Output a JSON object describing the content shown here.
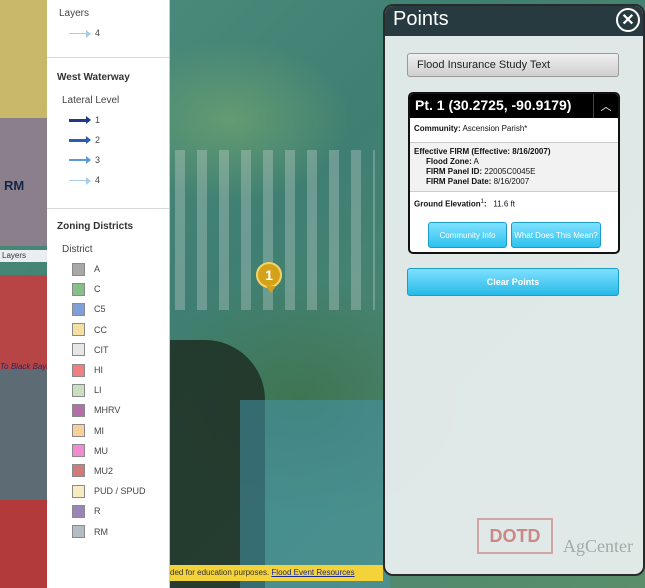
{
  "legend": {
    "layers_title": "Layers",
    "layers_item": "4",
    "west_waterway": {
      "heading": "West Waterway",
      "sub": "Lateral Level",
      "items": [
        {
          "label": "1",
          "color": "#1f3a80"
        },
        {
          "label": "2",
          "color": "#2a5cb0"
        },
        {
          "label": "3",
          "color": "#5b9ad8"
        },
        {
          "label": "4",
          "color": "#a9cbe8"
        }
      ]
    },
    "zoning": {
      "heading": "Zoning Districts",
      "sub": "District",
      "items": [
        {
          "label": "A",
          "color": "#a8a8a8"
        },
        {
          "label": "C",
          "color": "#86c086"
        },
        {
          "label": "C5",
          "color": "#7f9fd8"
        },
        {
          "label": "CC",
          "color": "#f6dfa0"
        },
        {
          "label": "CIT",
          "color": "#e6e6e6"
        },
        {
          "label": "HI",
          "color": "#f08080"
        },
        {
          "label": "LI",
          "color": "#c8dfc0"
        },
        {
          "label": "MHRV",
          "color": "#b46ea8"
        },
        {
          "label": "MI",
          "color": "#f6d29a"
        },
        {
          "label": "MU",
          "color": "#f08ccf"
        },
        {
          "label": "MU2",
          "color": "#d27a7a"
        },
        {
          "label": "PUD / SPUD",
          "color": "#f6ecbf"
        },
        {
          "label": "R",
          "color": "#9a86b6"
        },
        {
          "label": "RM",
          "color": "#b4bcc4"
        }
      ]
    }
  },
  "map": {
    "rm_label": "RM",
    "road_label": "To Black Bayou",
    "layers_tab": "Layers",
    "marker_number": "1"
  },
  "points": {
    "title": "Points",
    "close_icon": "close-icon",
    "fis_button": "Flood Insurance Study Text",
    "card": {
      "title": "Pt. 1 (30.2725, -90.9179)",
      "community_label": "Community:",
      "community_value": "Ascension Parish*",
      "firm_heading": "Effective FIRM (Effective:  8/16/2007)",
      "flood_zone_label": "Flood Zone:",
      "flood_zone_value": "A",
      "panel_id_label": "FIRM Panel ID:",
      "panel_id_value": "22005C0045E",
      "panel_date_label": "FIRM Panel Date:",
      "panel_date_value": "8/16/2007",
      "elevation_label": "Ground Elevation",
      "elevation_sup": "1",
      "elevation_colon": ":",
      "elevation_value": "11.6 ft",
      "community_info_button": "Community Info",
      "what_does_button": "What Does This Mean?"
    },
    "clear_button": "Clear Points",
    "logo_dotd": "DOTD",
    "logo_agcenter": "AgCenter"
  },
  "footer": {
    "text": "ded for education purposes.",
    "link": "Flood Event Resources"
  },
  "colors": {
    "header_bg": "#263a40",
    "accent_button": "#2ec1ee",
    "footer_bg": "#f4d23a"
  }
}
